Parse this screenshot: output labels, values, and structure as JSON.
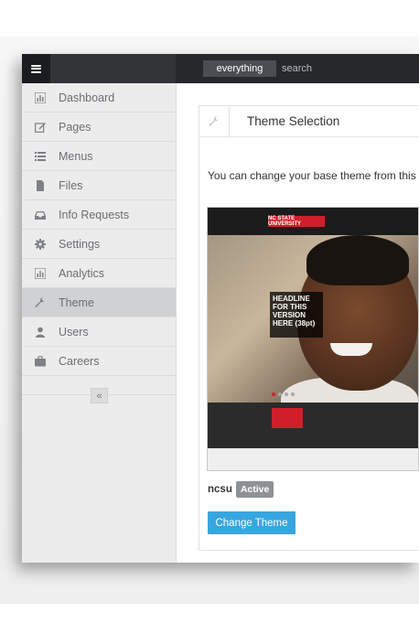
{
  "topbar": {
    "search_scope": "everything",
    "search_placeholder": "search"
  },
  "sidebar": {
    "items": [
      {
        "label": "Dashboard",
        "icon": "bar-chart-icon",
        "active": false
      },
      {
        "label": "Pages",
        "icon": "edit-icon",
        "active": false
      },
      {
        "label": "Menus",
        "icon": "list-icon",
        "active": false
      },
      {
        "label": "Files",
        "icon": "file-icon",
        "active": false
      },
      {
        "label": "Info Requests",
        "icon": "inbox-icon",
        "active": false
      },
      {
        "label": "Settings",
        "icon": "gear-icon",
        "active": false
      },
      {
        "label": "Analytics",
        "icon": "bar-chart-icon",
        "active": false
      },
      {
        "label": "Theme",
        "icon": "wrench-icon",
        "active": true
      },
      {
        "label": "Users",
        "icon": "user-icon",
        "active": false
      },
      {
        "label": "Careers",
        "icon": "briefcase-icon",
        "active": false
      }
    ],
    "collapse_glyph": "«"
  },
  "panel": {
    "title": "Theme Selection",
    "intro": "You can change your base theme from this a",
    "theme_name": "ncsu",
    "status_badge": "Active",
    "change_button": "Change Theme",
    "preview": {
      "logo_text": "NC STATE UNIVERSITY",
      "headline": "HEADLINE FOR THIS VERSION HERE (38pt)"
    }
  },
  "colors": {
    "topbar": "#26282c",
    "sidebar": "#ececec",
    "active_item": "#cfd1d3",
    "primary_button": "#37a6e0",
    "badge": "#8e9296"
  }
}
